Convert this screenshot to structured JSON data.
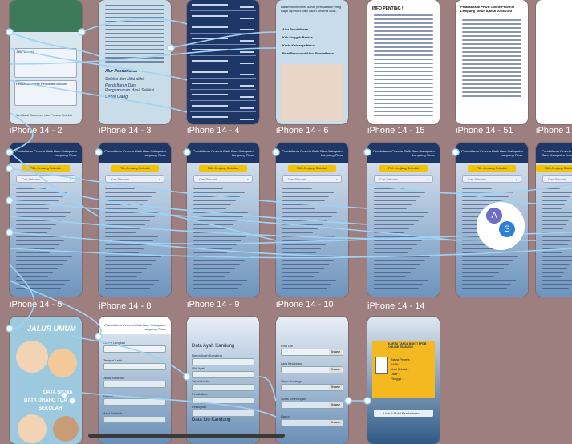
{
  "canvas": {
    "background": "#9d7f7f",
    "connector_color": "#9fd3f5"
  },
  "frames_row1": [
    {
      "label": "iPhone 14 - 2"
    },
    {
      "label": "iPhone 14 - 3"
    },
    {
      "label": "iPhone 14 - 4"
    },
    {
      "label": "iPhone 14 - 6"
    },
    {
      "label": "iPhone 14 - 15"
    },
    {
      "label": "iPhone 14 - 51"
    },
    {
      "label": "iPhone 1"
    }
  ],
  "frames_row2": [
    {
      "label": "iPhone 14 - 5"
    },
    {
      "label": "iPhone 14 - 8"
    },
    {
      "label": "iPhone 14 - 9"
    },
    {
      "label": "iPhone 14 - 10"
    },
    {
      "label": "iPhone 14 - 14"
    }
  ],
  "row2_screen": {
    "header_title": "Pendaftaran Peserta Didik Baru Kabupaten Lampung Timur",
    "banner": "Pilih Jenjang Sekolah",
    "search_placeholder": "Cari Sekolah"
  },
  "row1_text": {
    "f3_title": "Alur Pendaftaran",
    "f3_lines": [
      "Seleksi dan Nilai akhir",
      "Pendaftaran Dan Pengumuman Hasil Seleksi",
      "Daftar Ulang"
    ],
    "f6_intro": "Halaman ini berisi daftar persyaratan yang wajib dipenuhi oleh calon peserta didik.",
    "f6_items": [
      "Alur Pendaftaran",
      "Kab Unggah Berkas",
      "Kartu Keluarga Harus",
      "Buat Password Akun Pendaftaran"
    ],
    "f15_title": "INFO PENTING !!",
    "f51_title": "Pelaksanaan PPDB Online Provinsi Lampung Tahun Ajaran 2024/2025",
    "f2_sections": [
      "Jalur Zonasi",
      "Pendaftaran dan Pemilihan Sekolah",
      "Verifikasi Dokumen dan Proses Seleksi"
    ]
  },
  "row3_text": {
    "jalur_title": "JALUR UMUM",
    "jalur_lines": [
      "DATA SISWA",
      "DATA ORANG TUA",
      "SEKOLAH"
    ],
    "form_labels": [
      "Nama Lengkap",
      "Tempat Lahir",
      "Jenis Kelamin",
      "Alamat",
      "Asal Sekolah"
    ],
    "parent_title": "Data Ayah Kandung",
    "parent_fields": [
      "Nama Ayah Kandung",
      "NIK Ayah",
      "Tahun Lahir",
      "Pendidikan",
      "Pekerjaan"
    ],
    "mother_title": "Data Ibu Kandung",
    "upload_title": "Foto Diri",
    "upload_button": "Browse",
    "upload_fields": [
      "Foto Diri",
      "Akta Kelahiran",
      "Kartu Keluarga",
      "Surat Keterangan",
      "Rapor"
    ],
    "card_title": "KARTU TANDA BUKTI PPDB ONLINE 2024/2025",
    "card_fields": [
      "Nama Peserta",
      "NISN",
      "Asal Sekolah",
      "Jalur",
      "Tanggal"
    ],
    "card_button": "Unduh Bukti Pendaftaran"
  },
  "collaborators": [
    {
      "initial": "A",
      "color": "#6f6ec4"
    },
    {
      "initial": "S",
      "color": "#2f7fd8"
    }
  ]
}
